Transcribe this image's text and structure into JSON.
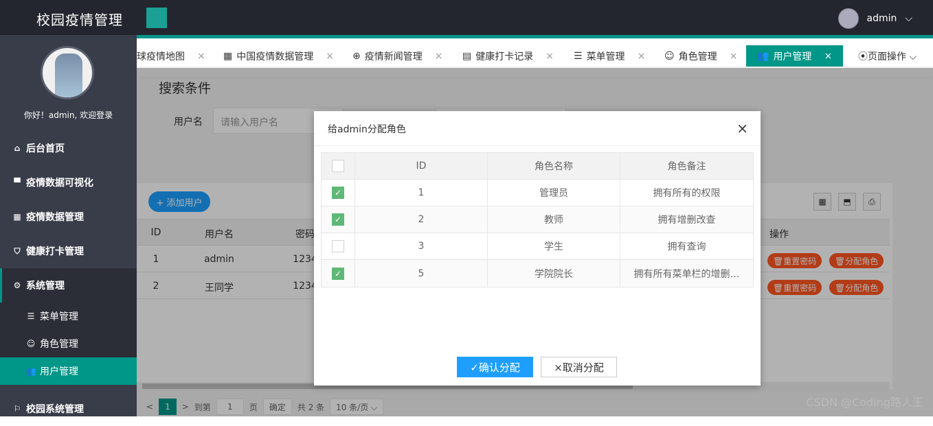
{
  "header": {
    "title": "校园疫情管理",
    "username": "admin",
    "user_caret": "⌵"
  },
  "sidebar": {
    "welcome": "你好！admin, 欢迎登录",
    "items": [
      {
        "icon": "home-icon",
        "glyph": "⌂",
        "label": "后台首页"
      },
      {
        "icon": "monitor-icon",
        "glyph": "▀",
        "label": "疫情数据可视化"
      },
      {
        "icon": "table-icon",
        "glyph": "▦",
        "label": "疫情数据管理"
      },
      {
        "icon": "shield-icon",
        "glyph": "⛉",
        "label": "健康打卡管理"
      },
      {
        "icon": "gear-icon",
        "glyph": "⚙",
        "label": "系统管理"
      },
      {
        "icon": "flag-icon",
        "glyph": "⚐",
        "label": "校园系统管理"
      }
    ],
    "subitems": [
      {
        "icon": "list-icon",
        "glyph": "☰",
        "label": "菜单管理"
      },
      {
        "icon": "smile-icon",
        "glyph": "☺",
        "label": "角色管理"
      },
      {
        "icon": "users-icon",
        "glyph": "👥",
        "label": "用户管理"
      }
    ]
  },
  "tabs": [
    {
      "glyph": "",
      "label": "球疫情地图"
    },
    {
      "glyph": "▦",
      "label": "中国疫情数据管理"
    },
    {
      "glyph": "⊕",
      "label": "疫情新闻管理"
    },
    {
      "glyph": "▤",
      "label": "健康打卡记录"
    },
    {
      "glyph": "☰",
      "label": "菜单管理"
    },
    {
      "glyph": "☺",
      "label": "角色管理"
    },
    {
      "glyph": "👥",
      "label": "用户管理"
    }
  ],
  "tab_close": "×",
  "page_ops": "⦿页面操作 ⌵",
  "search": {
    "legend": "搜索条件",
    "username_label": "用户名",
    "username_placeholder": "请输入用户名"
  },
  "toolbar": {
    "add_user": "+ 添加用户",
    "tool_icons": [
      "▦",
      "⬒",
      "⎙"
    ]
  },
  "table": {
    "headers": [
      "ID",
      "用户名",
      "密码",
      "操作"
    ],
    "rows": [
      {
        "id": "1",
        "name": "admin",
        "pwd": "1234"
      },
      {
        "id": "2",
        "name": "王同学",
        "pwd": "1234"
      }
    ],
    "reset_label": "🗑重置密码",
    "assign_label": "🗑分配角色"
  },
  "pager": {
    "prev": "<",
    "page": "1",
    "next": ">",
    "goto": "到第",
    "page_input": "1",
    "page_unit": "页",
    "confirm": "确定",
    "total": "共 2 条",
    "size": "10 条/页 ⌵"
  },
  "dialog": {
    "title": "给admin分配角色",
    "close": "×",
    "headers": [
      "ID",
      "角色名称",
      "角色备注"
    ],
    "rows": [
      {
        "checked": true,
        "id": "1",
        "name": "管理员",
        "note": "拥有所有的权限"
      },
      {
        "checked": true,
        "id": "2",
        "name": "教师",
        "note": "拥有增删改查"
      },
      {
        "checked": false,
        "id": "3",
        "name": "学生",
        "note": "拥有查询"
      },
      {
        "checked": true,
        "id": "5",
        "name": "学院院长",
        "note": "拥有所有菜单栏的增删…"
      }
    ],
    "confirm": "✓确认分配",
    "cancel": "×取消分配"
  },
  "watermark": "CSDN @Coding路人王"
}
